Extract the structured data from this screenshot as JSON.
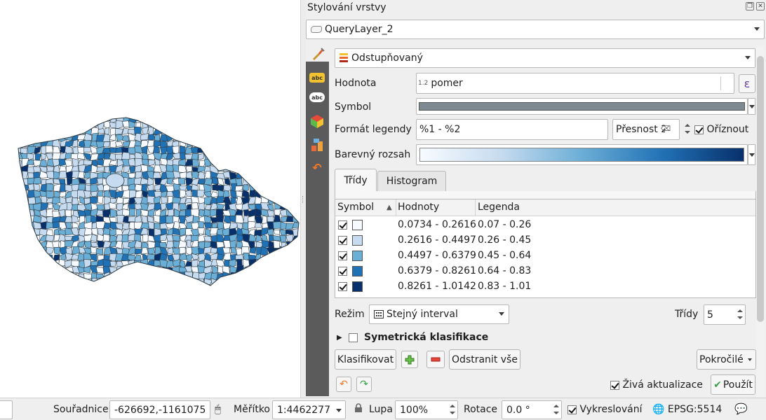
{
  "dock": {
    "title": "Stylování vrstvy",
    "layer": "QueryLayer_2"
  },
  "renderer": {
    "type": "Odstupňovaný",
    "value_label": "Hodnota",
    "value_field": "pomer",
    "value_field_type": "1.2",
    "expression_label": "ε",
    "symbol_label": "Symbol",
    "symbol_color": "#7d8a8f",
    "legend_format_label": "Formát legendy",
    "legend_format": "%1 - %2",
    "precision_placeholder": "Přesnost 2",
    "trim_label": "Oříznout",
    "trim_checked": true,
    "color_ramp_label": "Barevný rozsah",
    "color_ramp": [
      "#f7fbff",
      "#c6dbef",
      "#6baed6",
      "#2171b5",
      "#08306b"
    ]
  },
  "tabs": [
    {
      "label": "Třídy",
      "active": true
    },
    {
      "label": "Histogram",
      "active": false
    }
  ],
  "table": {
    "headers": [
      "Symbol",
      "Hodnoty",
      "Legenda"
    ],
    "rows": [
      {
        "checked": true,
        "color": "#f7fbff",
        "values": "0.0734 - 0.2616",
        "legend": "0.07 - 0.26"
      },
      {
        "checked": true,
        "color": "#c6dbef",
        "values": "0.2616 - 0.4497",
        "legend": "0.26 - 0.45"
      },
      {
        "checked": true,
        "color": "#6baed6",
        "values": "0.4497 - 0.6379",
        "legend": "0.45 - 0.64"
      },
      {
        "checked": true,
        "color": "#2171b5",
        "values": "0.6379 - 0.8261",
        "legend": "0.64 - 0.83"
      },
      {
        "checked": true,
        "color": "#08306b",
        "values": "0.8261 - 1.0142",
        "legend": "0.83 - 1.01"
      }
    ]
  },
  "mode": {
    "label": "Režim",
    "value": "Stejný interval",
    "classes_label": "Třídy",
    "classes_value": "5"
  },
  "symmetric": {
    "label": "Symetrická klasifikace",
    "checked": false
  },
  "buttons": {
    "classify": "Klasifikovat",
    "remove_all": "Odstranit vše",
    "advanced": "Pokročilé",
    "live_update": "Živá aktualizace",
    "live_update_checked": true,
    "apply": "Použít"
  },
  "statusbar": {
    "coordinate_label": "Souřadnice",
    "coordinate": "-626692,-1161075",
    "scale_label": "Měřítko",
    "scale": "1:4462277",
    "magnifier_label": "Lupa",
    "magnifier": "100%",
    "rotation_label": "Rotace",
    "rotation": "0.0 °",
    "render_label": "Vykreslování",
    "render_checked": true,
    "crs": "EPSG:5514"
  }
}
